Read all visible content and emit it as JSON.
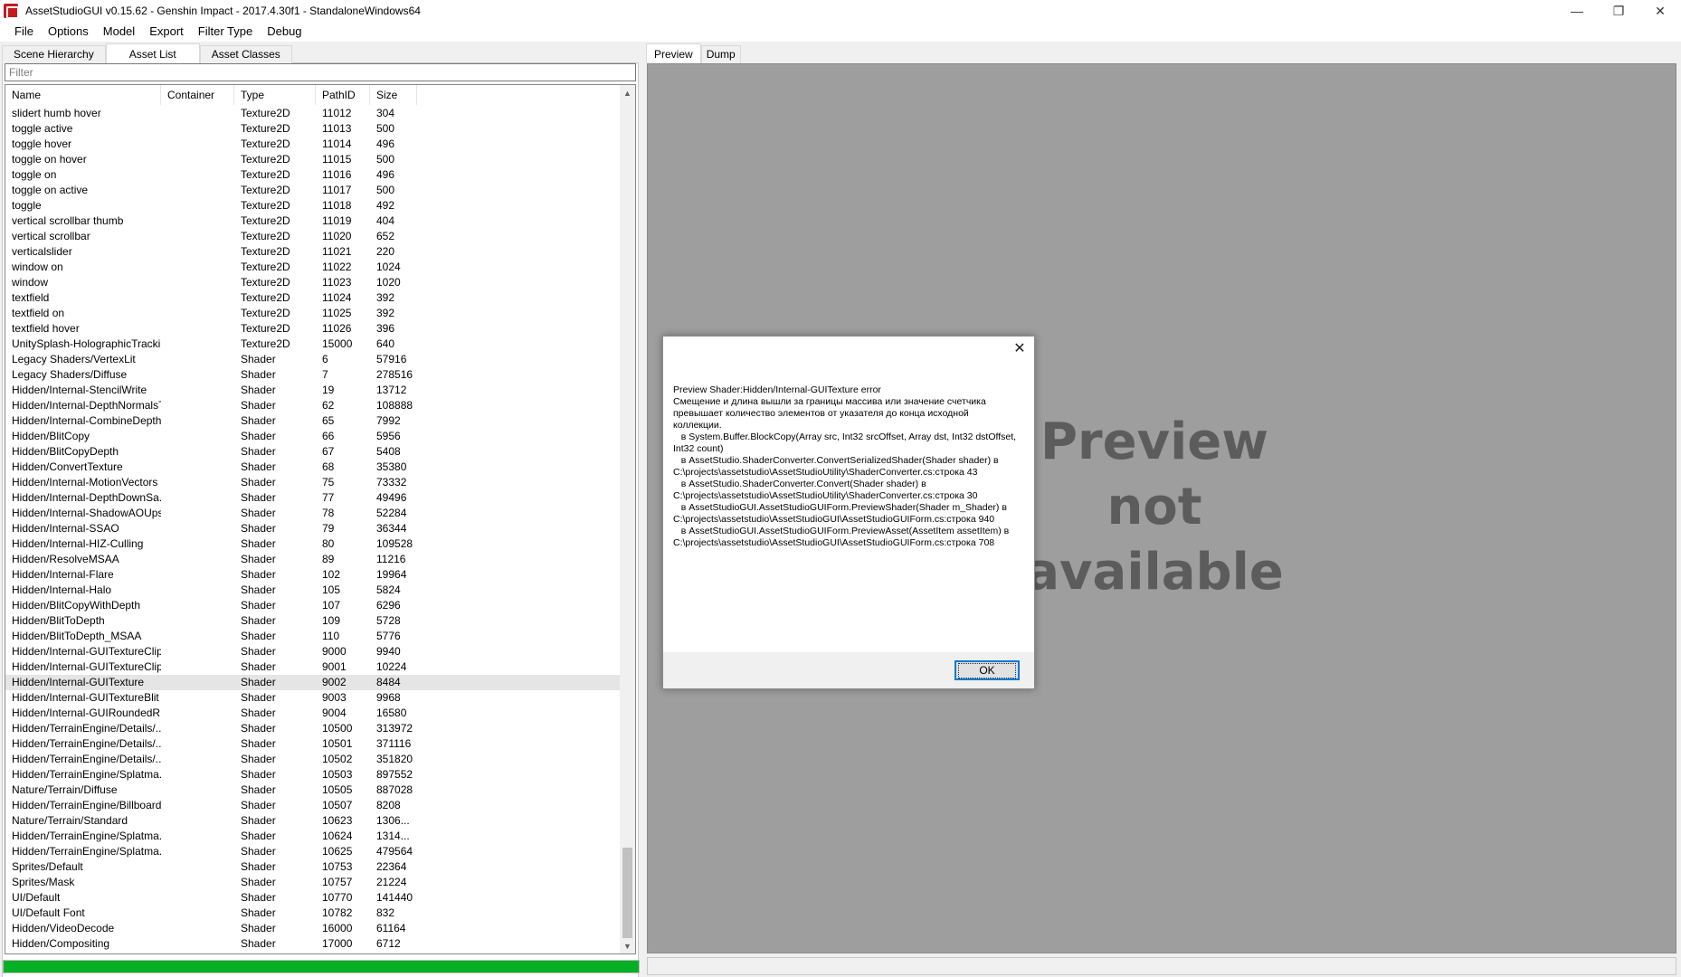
{
  "window": {
    "title": "AssetStudioGUI v0.15.62 - Genshin Impact - 2017.4.30f1 - StandaloneWindows64",
    "controls": {
      "minimize": "—",
      "restore": "❐",
      "close": "✕"
    }
  },
  "menu": [
    "File",
    "Options",
    "Model",
    "Export",
    "Filter Type",
    "Debug"
  ],
  "left_tabs": [
    "Scene Hierarchy",
    "Asset List",
    "Asset Classes"
  ],
  "filter": {
    "placeholder": "Filter"
  },
  "columns": [
    "Name",
    "Container",
    "Type",
    "PathID",
    "Size"
  ],
  "rows": [
    [
      "slidert humb hover",
      "",
      "Texture2D",
      "11012",
      "304"
    ],
    [
      "toggle active",
      "",
      "Texture2D",
      "11013",
      "500"
    ],
    [
      "toggle hover",
      "",
      "Texture2D",
      "11014",
      "496"
    ],
    [
      "toggle on hover",
      "",
      "Texture2D",
      "11015",
      "500"
    ],
    [
      "toggle on",
      "",
      "Texture2D",
      "11016",
      "496"
    ],
    [
      "toggle on active",
      "",
      "Texture2D",
      "11017",
      "500"
    ],
    [
      "toggle",
      "",
      "Texture2D",
      "11018",
      "492"
    ],
    [
      "vertical scrollbar thumb",
      "",
      "Texture2D",
      "11019",
      "404"
    ],
    [
      "vertical scrollbar",
      "",
      "Texture2D",
      "11020",
      "652"
    ],
    [
      "verticalslider",
      "",
      "Texture2D",
      "11021",
      "220"
    ],
    [
      "window on",
      "",
      "Texture2D",
      "11022",
      "1024"
    ],
    [
      "window",
      "",
      "Texture2D",
      "11023",
      "1020"
    ],
    [
      "textfield",
      "",
      "Texture2D",
      "11024",
      "392"
    ],
    [
      "textfield on",
      "",
      "Texture2D",
      "11025",
      "392"
    ],
    [
      "textfield hover",
      "",
      "Texture2D",
      "11026",
      "396"
    ],
    [
      "UnitySplash-HolographicTrackin...",
      "",
      "Texture2D",
      "15000",
      "640"
    ],
    [
      "Legacy Shaders/VertexLit",
      "",
      "Shader",
      "6",
      "57916"
    ],
    [
      "Legacy Shaders/Diffuse",
      "",
      "Shader",
      "7",
      "278516"
    ],
    [
      "Hidden/Internal-StencilWrite",
      "",
      "Shader",
      "19",
      "13712"
    ],
    [
      "Hidden/Internal-DepthNormalsT...",
      "",
      "Shader",
      "62",
      "108888"
    ],
    [
      "Hidden/Internal-CombineDepth...",
      "",
      "Shader",
      "65",
      "7992"
    ],
    [
      "Hidden/BlitCopy",
      "",
      "Shader",
      "66",
      "5956"
    ],
    [
      "Hidden/BlitCopyDepth",
      "",
      "Shader",
      "67",
      "5408"
    ],
    [
      "Hidden/ConvertTexture",
      "",
      "Shader",
      "68",
      "35380"
    ],
    [
      "Hidden/Internal-MotionVectors",
      "",
      "Shader",
      "75",
      "73332"
    ],
    [
      "Hidden/Internal-DepthDownSa...",
      "",
      "Shader",
      "77",
      "49496"
    ],
    [
      "Hidden/Internal-ShadowAOUps...",
      "",
      "Shader",
      "78",
      "52284"
    ],
    [
      "Hidden/Internal-SSAO",
      "",
      "Shader",
      "79",
      "36344"
    ],
    [
      "Hidden/Internal-HIZ-Culling",
      "",
      "Shader",
      "80",
      "109528"
    ],
    [
      "Hidden/ResolveMSAA",
      "",
      "Shader",
      "89",
      "11216"
    ],
    [
      "Hidden/Internal-Flare",
      "",
      "Shader",
      "102",
      "19964"
    ],
    [
      "Hidden/Internal-Halo",
      "",
      "Shader",
      "105",
      "5824"
    ],
    [
      "Hidden/BlitCopyWithDepth",
      "",
      "Shader",
      "107",
      "6296"
    ],
    [
      "Hidden/BlitToDepth",
      "",
      "Shader",
      "109",
      "5728"
    ],
    [
      "Hidden/BlitToDepth_MSAA",
      "",
      "Shader",
      "110",
      "5776"
    ],
    [
      "Hidden/Internal-GUITextureClip",
      "",
      "Shader",
      "9000",
      "9940"
    ],
    [
      "Hidden/Internal-GUITextureClip...",
      "",
      "Shader",
      "9001",
      "10224"
    ],
    [
      "Hidden/Internal-GUITexture",
      "",
      "Shader",
      "9002",
      "8484"
    ],
    [
      "Hidden/Internal-GUITextureBlit",
      "",
      "Shader",
      "9003",
      "9968"
    ],
    [
      "Hidden/Internal-GUIRoundedR...",
      "",
      "Shader",
      "9004",
      "16580"
    ],
    [
      "Hidden/TerrainEngine/Details/...",
      "",
      "Shader",
      "10500",
      "313972"
    ],
    [
      "Hidden/TerrainEngine/Details/...",
      "",
      "Shader",
      "10501",
      "371116"
    ],
    [
      "Hidden/TerrainEngine/Details/...",
      "",
      "Shader",
      "10502",
      "351820"
    ],
    [
      "Hidden/TerrainEngine/Splatma...",
      "",
      "Shader",
      "10503",
      "897552"
    ],
    [
      "Nature/Terrain/Diffuse",
      "",
      "Shader",
      "10505",
      "887028"
    ],
    [
      "Hidden/TerrainEngine/Billboard...",
      "",
      "Shader",
      "10507",
      "8208"
    ],
    [
      "Nature/Terrain/Standard",
      "",
      "Shader",
      "10623",
      "1306..."
    ],
    [
      "Hidden/TerrainEngine/Splatma...",
      "",
      "Shader",
      "10624",
      "1314..."
    ],
    [
      "Hidden/TerrainEngine/Splatma...",
      "",
      "Shader",
      "10625",
      "479564"
    ],
    [
      "Sprites/Default",
      "",
      "Shader",
      "10753",
      "22364"
    ],
    [
      "Sprites/Mask",
      "",
      "Shader",
      "10757",
      "21224"
    ],
    [
      "UI/Default",
      "",
      "Shader",
      "10770",
      "141440"
    ],
    [
      "UI/Default Font",
      "",
      "Shader",
      "10782",
      "832"
    ],
    [
      "Hidden/VideoDecode",
      "",
      "Shader",
      "16000",
      "61164"
    ],
    [
      "Hidden/Compositing",
      "",
      "Shader",
      "17000",
      "6712"
    ]
  ],
  "selected_row": "Hidden/Internal-GUITexture",
  "progress": {
    "fraction": 1.0,
    "color": "#06b025"
  },
  "right_tabs": [
    "Preview",
    "Dump"
  ],
  "preview_message": [
    "Preview",
    "not",
    "available"
  ],
  "dialog": {
    "message": "Preview Shader:Hidden/Internal-GUITexture error\nСмещение и длина вышли за границы массива или значение счетчика превышает количество элементов от указателя до конца исходной коллекции.\n   в System.Buffer.BlockCopy(Array src, Int32 srcOffset, Array dst, Int32 dstOffset, Int32 count)\n   в AssetStudio.ShaderConverter.ConvertSerializedShader(Shader shader) в C:\\projects\\assetstudio\\AssetStudioUtility\\ShaderConverter.cs:строка 43\n   в AssetStudio.ShaderConverter.Convert(Shader shader) в C:\\projects\\assetstudio\\AssetStudioUtility\\ShaderConverter.cs:строка 30\n   в AssetStudioGUI.AssetStudioGUIForm.PreviewShader(Shader m_Shader) в C:\\projects\\assetstudio\\AssetStudioGUI\\AssetStudioGUIForm.cs:строка 940\n   в AssetStudioGUI.AssetStudioGUIForm.PreviewAsset(AssetItem assetItem) в C:\\projects\\assetstudio\\AssetStudioGUI\\AssetStudioGUIForm.cs:строка 708",
    "ok_label": "OK",
    "close_glyph": "✕"
  },
  "icons": {
    "app": "asset-studio-icon",
    "scroll_up": "▲",
    "scroll_down": "▼"
  }
}
